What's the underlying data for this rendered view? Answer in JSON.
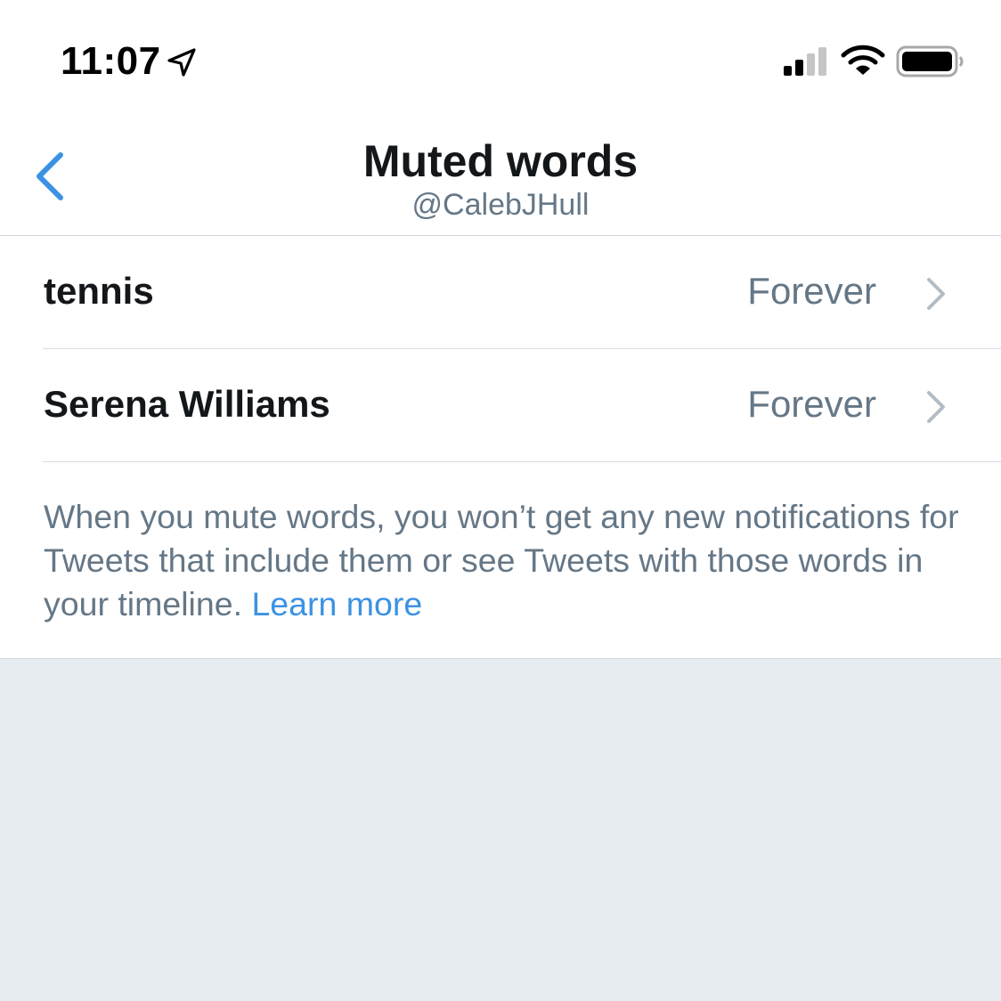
{
  "status_bar": {
    "time": "11:07",
    "location_icon": "location-arrow-icon",
    "signal_icon": "cellular-signal-icon",
    "wifi_icon": "wifi-icon",
    "battery_icon": "battery-icon"
  },
  "header": {
    "back_icon": "chevron-left-icon",
    "title": "Muted words",
    "subtitle": "@CalebJHull"
  },
  "muted_words": [
    {
      "word": "tennis",
      "duration": "Forever"
    },
    {
      "word": "Serena Williams",
      "duration": "Forever"
    }
  ],
  "footer": {
    "info_text": "When you mute words, you won’t get any new notifications for Tweets that include them or see Tweets with those words in your timeline. ",
    "link_text": "Learn more"
  },
  "colors": {
    "accent": "#3b92e3",
    "secondary_text": "#657786",
    "primary_text": "#14171a",
    "background": "#e6ecf0"
  }
}
